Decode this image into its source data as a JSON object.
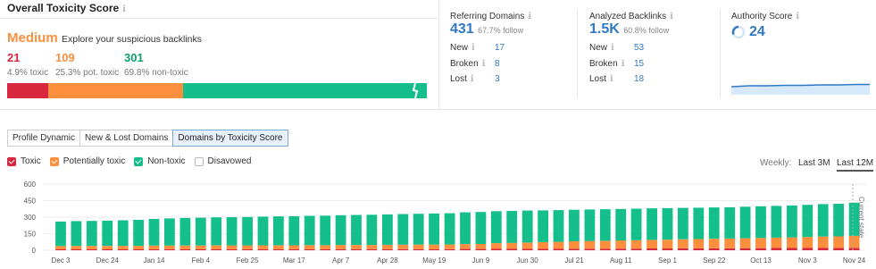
{
  "toxicity": {
    "title": "Overall Toxicity Score",
    "severity": "Medium",
    "severity_text": "Explore your suspicious backlinks",
    "toxic_count": "21",
    "toxic_pct": "4.9% toxic",
    "pot_count": "109",
    "pot_pct": "25.3% pot. toxic",
    "non_count": "301",
    "non_pct": "69.8% non-toxic",
    "bar_fractions": {
      "toxic": 0.049,
      "potentially_toxic": 0.253,
      "non_toxic": 0.698
    }
  },
  "referring_domains": {
    "label": "Referring Domains",
    "value": "431",
    "follow": "67.7% follow",
    "rows": [
      {
        "label": "New",
        "value": "17"
      },
      {
        "label": "Broken",
        "value": "8"
      },
      {
        "label": "Lost",
        "value": "3"
      }
    ]
  },
  "analyzed_backlinks": {
    "label": "Analyzed Backlinks",
    "value": "1.5K",
    "follow": "60.8% follow",
    "rows": [
      {
        "label": "New",
        "value": "53"
      },
      {
        "label": "Broken",
        "value": "15"
      },
      {
        "label": "Lost",
        "value": "18"
      }
    ]
  },
  "authority": {
    "label": "Authority Score",
    "value": "24"
  },
  "tabs": [
    "Profile Dynamic",
    "New & Lost Domains",
    "Domains by Toxicity Score"
  ],
  "active_tab": 2,
  "legend": [
    {
      "label": "Toxic",
      "color": "#d8283f",
      "checked": true
    },
    {
      "label": "Potentially toxic",
      "color": "#fb8f3d",
      "checked": true
    },
    {
      "label": "Non-toxic",
      "color": "#14bf8c",
      "checked": true
    },
    {
      "label": "Disavowed",
      "color": "#ffffff",
      "checked": false
    }
  ],
  "periods": {
    "label": "Weekly:",
    "options": [
      "Last 3M",
      "Last 12M"
    ],
    "selected": "Last 12M"
  },
  "colors": {
    "toxic": "#d8283f",
    "potentially_toxic": "#fb8f3d",
    "non_toxic": "#14bf8c",
    "accent": "#2f79c6",
    "severity": "#fb8f3d"
  },
  "chart_data": {
    "type": "bar",
    "stacked": true,
    "ylim": [
      0,
      600
    ],
    "yticks": [
      0,
      150,
      300,
      450,
      600
    ],
    "x_tick_labels": [
      "Dec 3",
      "Dec 24",
      "Jan 14",
      "Feb 4",
      "Feb 25",
      "Mar 17",
      "Apr 7",
      "Apr 28",
      "May 19",
      "Jun 9",
      "Jun 30",
      "Jul 21",
      "Aug 11",
      "Sep 1",
      "Sep 22",
      "Oct 13",
      "Nov 3",
      "Nov 24"
    ],
    "annotation": "Current state",
    "series": [
      {
        "name": "Toxic",
        "color": "#d8283f",
        "values": [
          8,
          8,
          8,
          8,
          8,
          8,
          9,
          9,
          9,
          9,
          9,
          9,
          9,
          9,
          9,
          9,
          9,
          9,
          10,
          10,
          10,
          10,
          10,
          10,
          10,
          10,
          11,
          11,
          12,
          12,
          12,
          12,
          12,
          13,
          14,
          14,
          15,
          15,
          16,
          16,
          17,
          17,
          18,
          18,
          19,
          19,
          20,
          20,
          20,
          20,
          20,
          21
        ]
      },
      {
        "name": "Potentially toxic",
        "color": "#fb8f3d",
        "values": [
          30,
          31,
          31,
          31,
          32,
          32,
          33,
          34,
          34,
          34,
          35,
          35,
          35,
          36,
          36,
          36,
          37,
          37,
          38,
          38,
          38,
          39,
          40,
          41,
          41,
          42,
          45,
          46,
          52,
          55,
          58,
          62,
          64,
          68,
          70,
          72,
          74,
          76,
          78,
          80,
          82,
          84,
          86,
          88,
          90,
          92,
          94,
          96,
          100,
          104,
          106,
          109
        ]
      },
      {
        "name": "Non-toxic",
        "color": "#14bf8c",
        "values": [
          222,
          225,
          227,
          229,
          232,
          236,
          242,
          246,
          250,
          252,
          254,
          256,
          258,
          260,
          262,
          264,
          266,
          268,
          270,
          272,
          274,
          276,
          278,
          280,
          282,
          284,
          288,
          290,
          290,
          290,
          290,
          288,
          288,
          286,
          286,
          286,
          286,
          286,
          286,
          286,
          285,
          285,
          284,
          284,
          286,
          288,
          288,
          290,
          292,
          294,
          296,
          301
        ]
      }
    ]
  }
}
